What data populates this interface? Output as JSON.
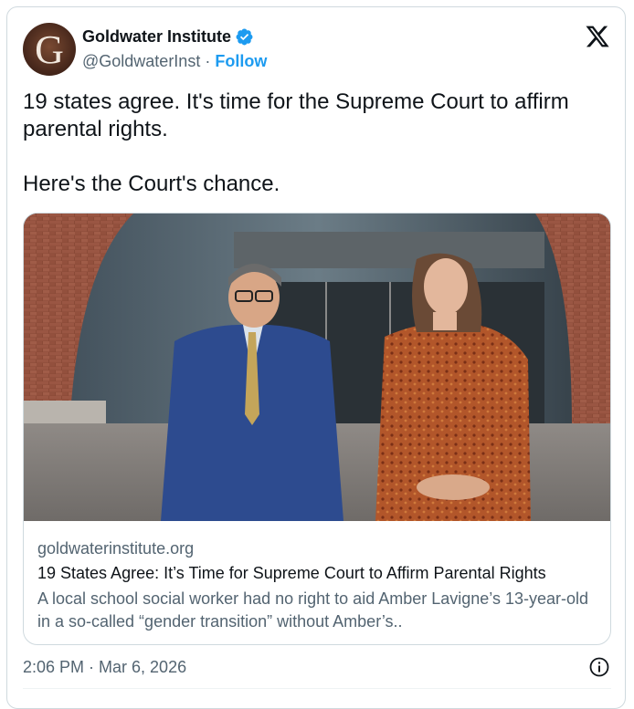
{
  "author": {
    "name": "Goldwater Institute",
    "handle": "@GoldwaterInst",
    "separator": "·",
    "follow_label": "Follow",
    "avatar_letter": "G",
    "verified": true
  },
  "tweet": {
    "text": "19 states agree. It's time for the Supreme Court to affirm parental rights.\n\nHere's the Court's chance."
  },
  "link_card": {
    "domain": "goldwaterinstitute.org",
    "title": "19 States Agree: It’s Time for Supreme Court to Affirm Parental Rights",
    "description": "A local school social worker had no right to aid Amber Lavigne’s 13-year-old in a so-called “gender transition” without Amber’s.."
  },
  "timestamp": "2:06 PM · Mar 6, 2026",
  "colors": {
    "accent": "#1d9bf0",
    "text": "#0f1419",
    "muted": "#536471",
    "border": "#cfd9de"
  },
  "icons": {
    "platform": "x-logo-icon",
    "verified": "verified-badge-icon",
    "info": "info-icon"
  }
}
